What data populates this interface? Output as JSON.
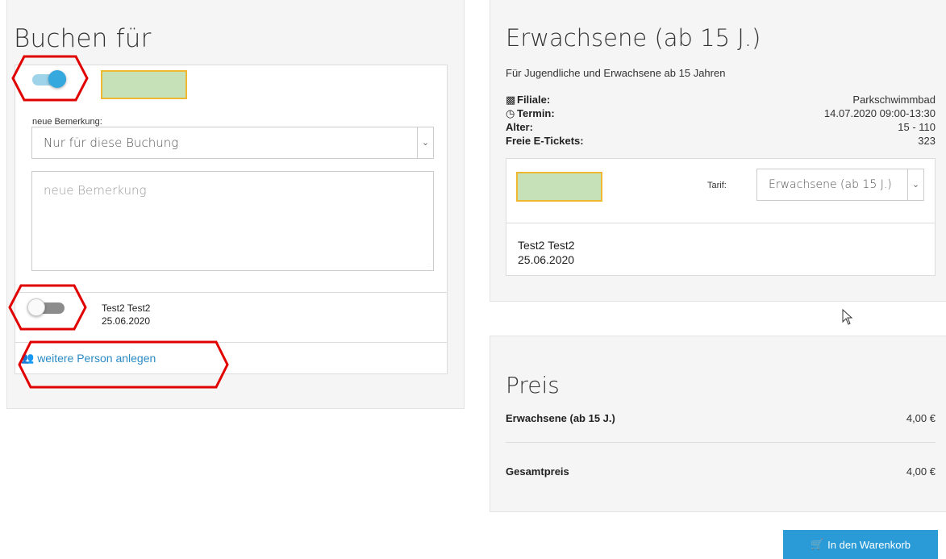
{
  "left": {
    "title": "Buchen für",
    "remark_label": "neue Bemerkung:",
    "remark_scope_selected": "Nur für diese Buchung",
    "remark_placeholder": "neue Bemerkung",
    "person": {
      "name": "Test2 Test2",
      "date": "25.06.2020"
    },
    "add_person_label": "weitere Person anlegen",
    "toggle_main_state": "on",
    "toggle_person_state": "off"
  },
  "right": {
    "title": "Erwachsene (ab 15 J.)",
    "subtitle": "Für Jugendliche und Erwachsene ab 15 Jahren",
    "info": [
      {
        "label": "Filiale:",
        "icon": "building-icon",
        "value": "Parkschwimmbad"
      },
      {
        "label": "Termin:",
        "icon": "clock-icon",
        "value": "14.07.2020 09:00-13:30"
      },
      {
        "label": "Alter:",
        "icon": "",
        "value": "15 - 110"
      },
      {
        "label": "Freie E-Tickets:",
        "icon": "",
        "value": "323"
      }
    ],
    "tarif_label": "Tarif:",
    "tarif_selected": "Erwachsene (ab 15 J.)",
    "person": {
      "name": "Test2 Test2",
      "date": "25.06.2020"
    }
  },
  "price": {
    "title": "Preis",
    "line_label": "Erwachsene (ab 15 J.)",
    "line_value": "4,00 €",
    "total_label": "Gesamtpreis",
    "total_value": "4,00 €"
  },
  "cart_button_label": "In den Warenkorb",
  "colors": {
    "accent": "#2a9bd6",
    "link": "#2a8ac4",
    "annotation_red": "#e00000",
    "redaction_fill": "#c6e0b8",
    "redaction_border": "#f0b830"
  }
}
